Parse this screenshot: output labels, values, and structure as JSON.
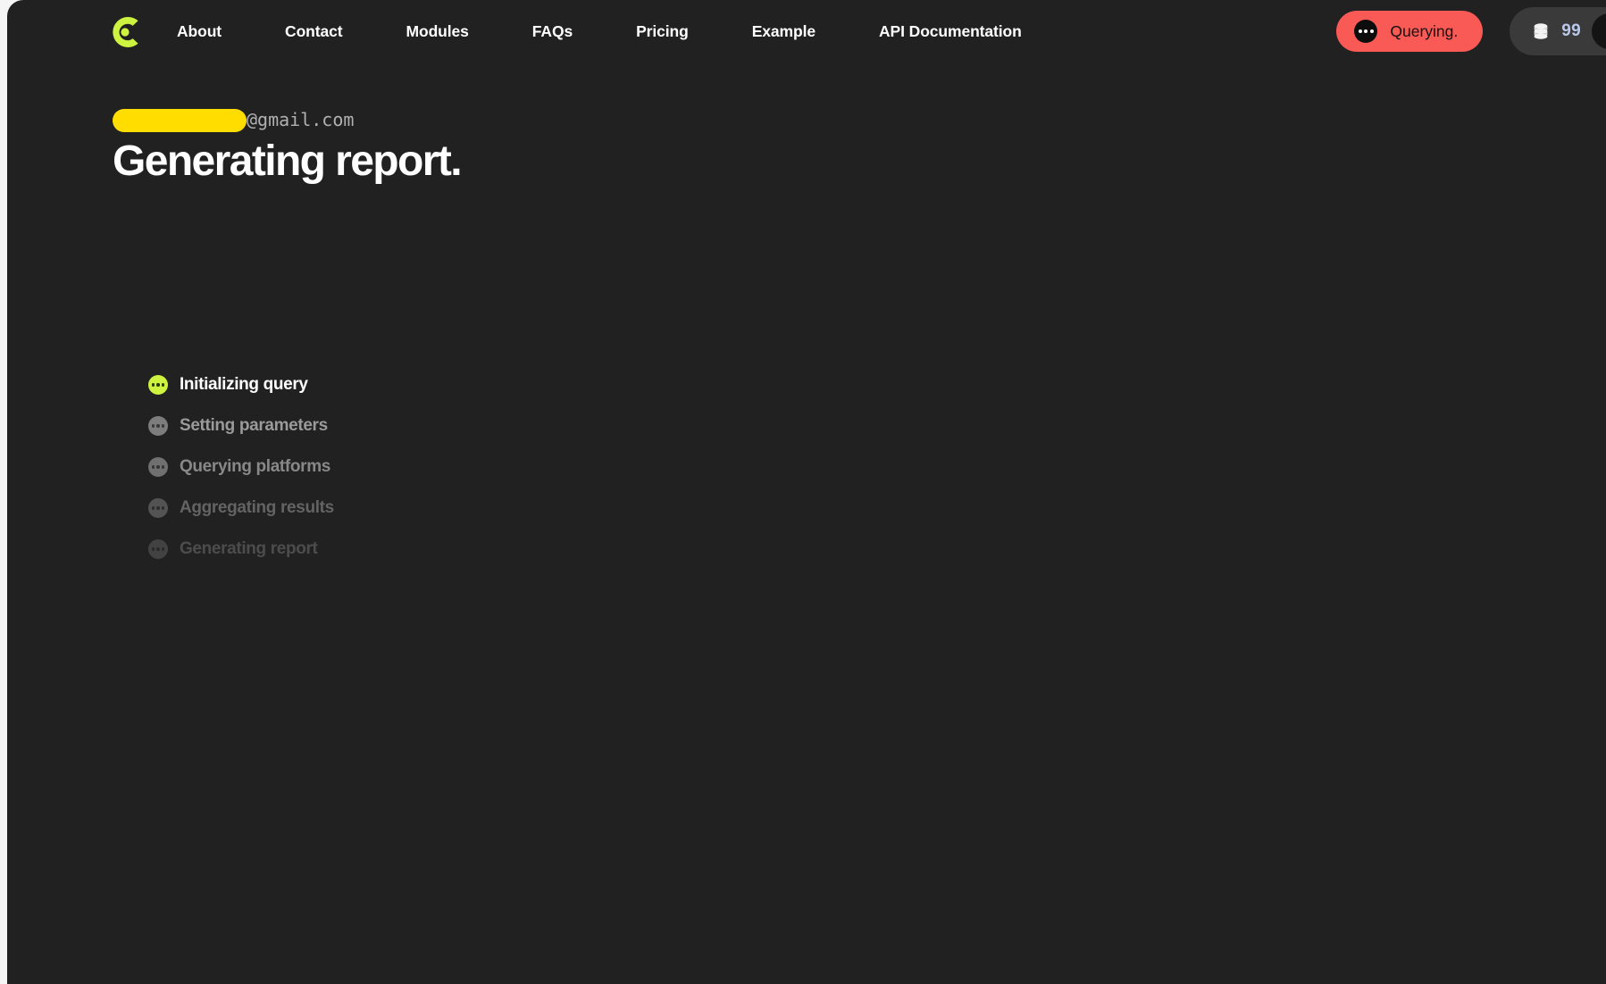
{
  "brand": {
    "logo_icon": "c-ring-logo-icon",
    "logo_color": "#cdf23f"
  },
  "nav": {
    "links": [
      {
        "label": "About"
      },
      {
        "label": "Contact"
      },
      {
        "label": "Modules"
      },
      {
        "label": "FAQs"
      },
      {
        "label": "Pricing"
      },
      {
        "label": "Example"
      },
      {
        "label": "API Documentation"
      }
    ]
  },
  "status": {
    "label": "Querying.",
    "icon": "ellipsis-icon",
    "color": "#fa5a55"
  },
  "credits": {
    "icon": "database-icon",
    "count": "99",
    "count_color": "#b9c8e8"
  },
  "account": {
    "redacted_user": "",
    "domain": "@gmail.com"
  },
  "main": {
    "title": "Generating report."
  },
  "steps": [
    {
      "label": "Initializing query",
      "state": "active"
    },
    {
      "label": "Setting parameters",
      "state": "pending"
    },
    {
      "label": "Querying platforms",
      "state": "pending"
    },
    {
      "label": "Aggregating results",
      "state": "pending"
    },
    {
      "label": "Generating report",
      "state": "pending"
    }
  ],
  "theme": {
    "background": "#212121",
    "accent": "#cdf23f",
    "alert": "#fa5a55",
    "redaction": "#ffdd00"
  }
}
